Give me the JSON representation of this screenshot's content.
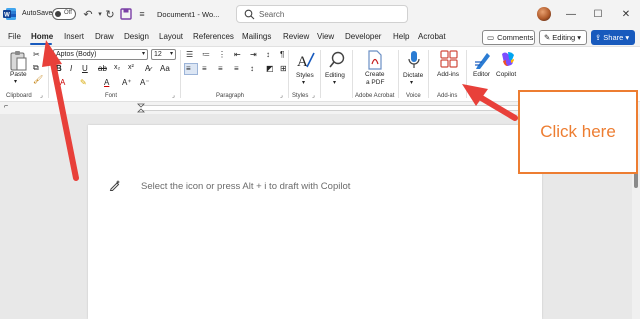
{
  "titlebar": {
    "autosave_label": "AutoSave",
    "autosave_state": "Off",
    "doc_title": "Document1 - Wo...",
    "search_placeholder": "Search"
  },
  "menu": {
    "tabs": [
      "File",
      "Home",
      "Insert",
      "Draw",
      "Design",
      "Layout",
      "References",
      "Mailings",
      "Review",
      "View",
      "Developer",
      "Help",
      "Acrobat"
    ],
    "active_tab": "Home",
    "comments_label": "Comments",
    "editing_label": "Editing",
    "share_label": "Share"
  },
  "ribbon": {
    "paste_label": "Paste",
    "font_name": "Aptos (Body)",
    "font_size": "12",
    "styles_label": "Styles",
    "editing_label": "Editing",
    "create_pdf_label_1": "Create",
    "create_pdf_label_2": "a PDF",
    "dictate_label": "Dictate",
    "addins_label": "Add-ins",
    "editor_label": "Editor",
    "copilot_label": "Copilot",
    "groups": {
      "clipboard": "Clipboard",
      "font": "Font",
      "paragraph": "Paragraph",
      "styles": "Styles",
      "adobe_acrobat": "Adobe Acrobat",
      "voice": "Voice",
      "addins": "Add-ins"
    }
  },
  "document": {
    "copilot_hint": "Select the icon or press Alt + i to draft with Copilot"
  },
  "callout": {
    "text": "Click here"
  },
  "colors": {
    "accent": "#185abd",
    "annotation": "#e8403a",
    "callout": "#ed7d31"
  }
}
